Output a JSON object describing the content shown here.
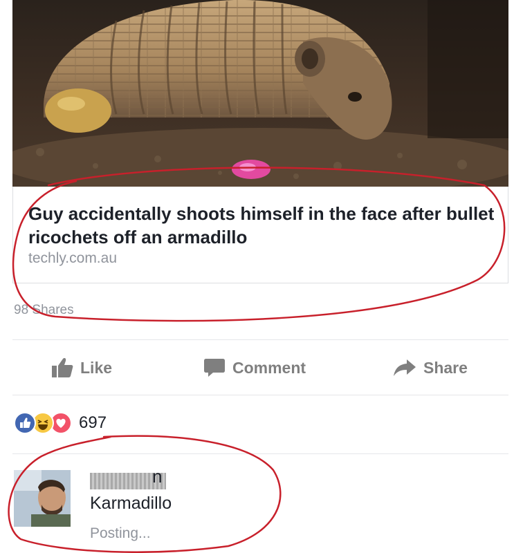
{
  "link_preview": {
    "image_subject": "armadillo",
    "headline": "Guy accidentally shoots himself in the face after bullet ricochets off an armadillo",
    "domain": "techly.com.au"
  },
  "post_stats": {
    "shares": "98 Shares"
  },
  "actions": {
    "like": "Like",
    "comment": "Comment",
    "share": "Share"
  },
  "reactions": {
    "icons": [
      "like-reaction-icon",
      "haha-reaction-icon",
      "love-reaction-icon"
    ],
    "count": "697"
  },
  "comment": {
    "author_visible_suffix": "n",
    "text": "Karmadillo",
    "status": "Posting..."
  },
  "colors": {
    "annotation_red": "#c8202b",
    "facebook_blue": "#4267b2",
    "love_red": "#f25268",
    "haha_yellow": "#f7c843",
    "muted_gray": "#90949c"
  }
}
